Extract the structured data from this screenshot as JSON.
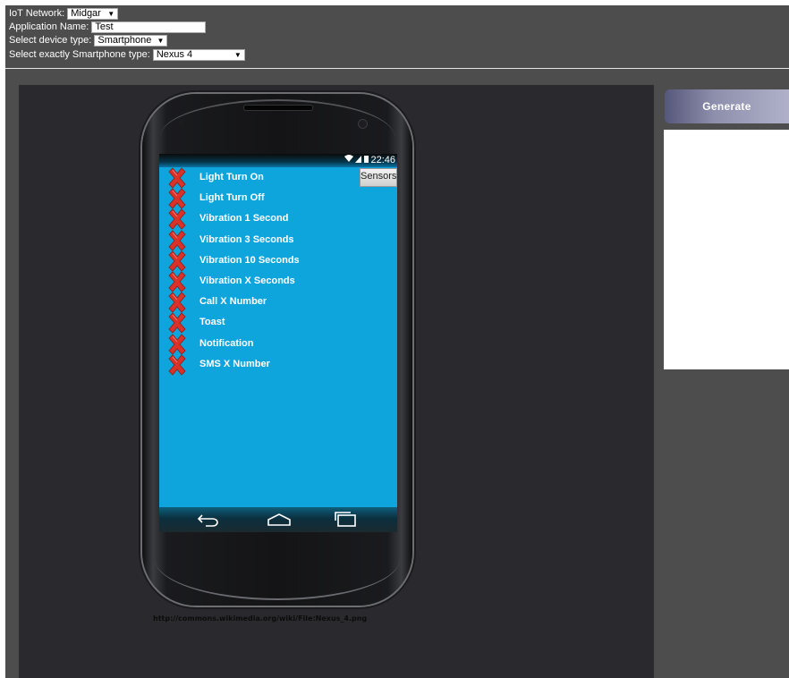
{
  "form": {
    "network_label": "IoT Network:",
    "network_value": "Midgar",
    "app_name_label": "Application Name:",
    "app_name_value": "Test",
    "device_type_label": "Select device type:",
    "device_type_value": "Smartphone",
    "phone_type_label": "Select exactly Smartphone type:",
    "phone_type_value": "Nexus 4"
  },
  "phone": {
    "status_time": "22:46",
    "sensors_label": "Sensors",
    "items": [
      {
        "label": "Light Turn On"
      },
      {
        "label": "Light Turn Off"
      },
      {
        "label": "Vibration 1 Second"
      },
      {
        "label": "Vibration 3 Seconds"
      },
      {
        "label": "Vibration 10 Seconds"
      },
      {
        "label": "Vibration X Seconds"
      },
      {
        "label": "Call X Number"
      },
      {
        "label": "Toast"
      },
      {
        "label": "Notification"
      },
      {
        "label": "SMS X Number"
      }
    ],
    "credit": "http://commons.wikimedia.org/wiki/File:Nexus_4.png"
  },
  "actions": {
    "generate_label": "Generate"
  },
  "icons": {
    "item_marker": "red-x-icon",
    "nav_back": "back-icon",
    "nav_home": "home-icon",
    "nav_recents": "recents-icon"
  },
  "colors": {
    "screen_bg": "#0ea5dd",
    "app_bg": "#4d4d4d",
    "stage_bg": "#2a2a2e",
    "marker": "#d9322a"
  }
}
